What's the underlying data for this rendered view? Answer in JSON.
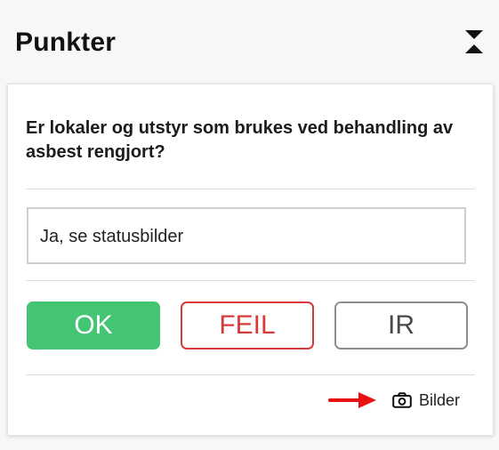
{
  "header": {
    "title": "Punkter",
    "collapse_icon": "collapse-expand-icon"
  },
  "item": {
    "question": "Er lokaler og utstyr som brukes ved behandling av asbest rengjort?",
    "answer": "Ja, se statusbilder",
    "buttons": {
      "ok": "OK",
      "feil": "FEIL",
      "ir": "IR"
    },
    "images_link": {
      "label": "Bilder",
      "icon": "camera-icon"
    },
    "annotation_arrow": "arrow-right-icon"
  },
  "colors": {
    "ok_green": "#44c573",
    "feil_red": "#d83a3a",
    "ir_gray": "#8e8e8e",
    "arrow_red": "#e81010"
  }
}
